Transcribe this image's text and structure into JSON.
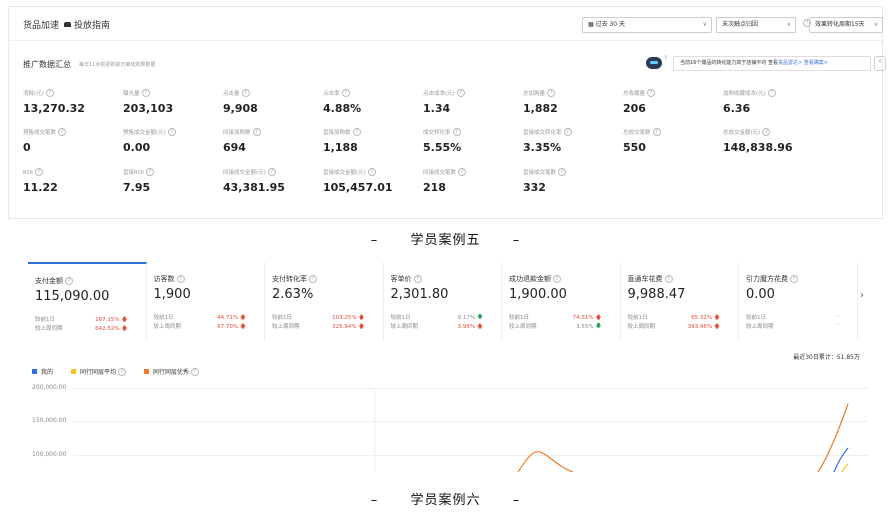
{
  "top": {
    "title": "货品加速",
    "guide": "投放指南",
    "date_filter": "过去 30 天",
    "attr_filter": "末次触点归因",
    "period_filter": "效果转化周期15天",
    "summary_title": "推广数据汇总",
    "summary_note": "每日11点前更新前日离线效果数据",
    "tip_text": "当前16个爆品的转化能力高于店铺平均 查看",
    "tip_link": "货品雷达> 查看确案>",
    "metrics": [
      {
        "label": "消耗(元)",
        "value": "13,270.32"
      },
      {
        "label": "曝光量",
        "value": "203,103"
      },
      {
        "label": "点击量",
        "value": "9,908"
      },
      {
        "label": "点击率",
        "value": "4.88%"
      },
      {
        "label": "点击成本(元)",
        "value": "1.34"
      },
      {
        "label": "总加购量",
        "value": "1,882"
      },
      {
        "label": "总收藏量",
        "value": "206"
      },
      {
        "label": "加购收藏成本(元)",
        "value": "6.36"
      },
      {
        "label": "预售成交笔数",
        "value": "0"
      },
      {
        "label": "预售成交金额(元)",
        "value": "0.00"
      },
      {
        "label": "间接加购数",
        "value": "694"
      },
      {
        "label": "直接加购数",
        "value": "1,188"
      },
      {
        "label": "成交转化率",
        "value": "5.55%"
      },
      {
        "label": "直接成交转化率",
        "value": "3.35%"
      },
      {
        "label": "总成交笔数",
        "value": "550"
      },
      {
        "label": "总成交金额(元)",
        "value": "148,838.96"
      },
      {
        "label": "ROI",
        "value": "11.22"
      },
      {
        "label": "直接ROI",
        "value": "7.95"
      },
      {
        "label": "间接成交金额(元)",
        "value": "43,381.95"
      },
      {
        "label": "直接成交金额(元)",
        "value": "105,457.01"
      },
      {
        "label": "间接成交笔数",
        "value": "218"
      },
      {
        "label": "直接成交笔数",
        "value": "332"
      }
    ]
  },
  "caption1": "学员案例五",
  "caption2": "学员案例六",
  "dash": "–",
  "bottom": {
    "cmp_prev_day": "较前1日",
    "cmp_prev_week": "较上周同期",
    "kpis": [
      {
        "label": "支付金额",
        "value": "115,090.00",
        "d": "167.15%",
        "w": "642.52%",
        "dd": "up",
        "wd": "up"
      },
      {
        "label": "访客数",
        "value": "1,900",
        "d": "44.71%",
        "w": "67.70%",
        "dd": "up",
        "wd": "up"
      },
      {
        "label": "支付转化率",
        "value": "2.63%",
        "d": "103.25%",
        "w": "325.94%",
        "dd": "up",
        "wd": "up"
      },
      {
        "label": "客单价",
        "value": "2,301.80",
        "d": "9.17%",
        "w": "3.95%",
        "dd": "down",
        "wd": "up"
      },
      {
        "label": "成功退款金额",
        "value": "1,900.00",
        "d": "74.31%",
        "w": "3.55%",
        "dd": "up",
        "wd": "down"
      },
      {
        "label": "直通车花费",
        "value": "9,988.47",
        "d": "65.31%",
        "w": "393.96%",
        "dd": "up",
        "wd": "up"
      },
      {
        "label": "引力魔方花费",
        "value": "0.00",
        "d": "-",
        "w": "-",
        "dd": "none",
        "wd": "none"
      }
    ],
    "total30": "最近30日累计：51.85万",
    "legend": [
      "我的",
      "同行同层平均",
      "同行同层优秀"
    ],
    "colors": {
      "mine": "#2f6ee0",
      "avg": "#f5c518",
      "top": "#f07b2a"
    },
    "y_ticks": [
      "200,000.00",
      "150,000.00",
      "100,000.00"
    ]
  }
}
